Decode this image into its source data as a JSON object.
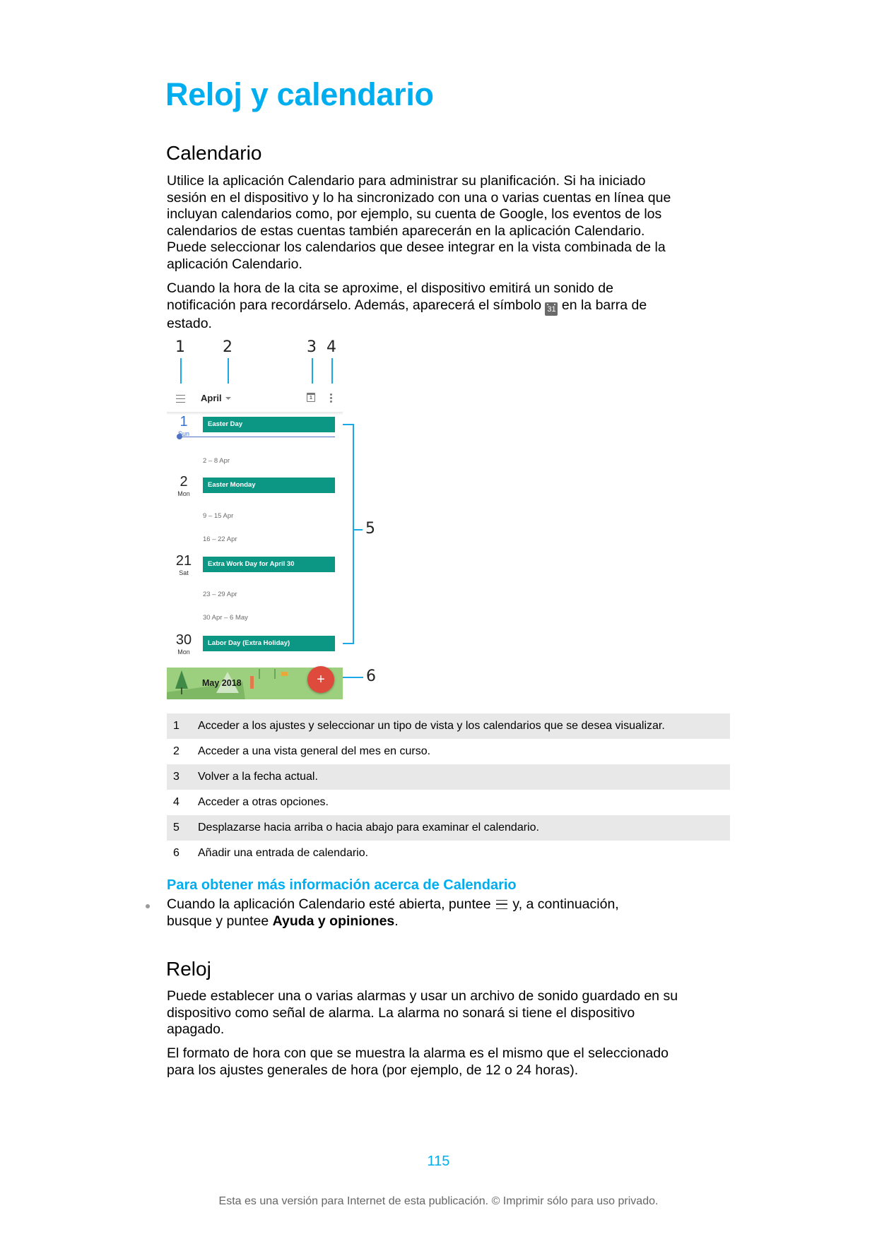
{
  "title": "Reloj y calendario",
  "calendar_section": {
    "heading": "Calendario",
    "para1_lines": [
      "Utilice la aplicación Calendario para administrar su planificación. Si ha iniciado",
      "sesión en el dispositivo y lo ha sincronizado con una o varias cuentas en línea que",
      "incluyan calendarios como, por ejemplo, su cuenta de Google, los eventos de los",
      "calendarios de estas cuentas también aparecerán en la aplicación Calendario.",
      "Puede seleccionar los calendarios que desee integrar en la vista combinada de la",
      "aplicación Calendario."
    ],
    "para2_line1": "Cuando la hora de la cita se aproxime, el dispositivo emitirá un sonido de",
    "para2_line2_before": "notificación para recordárselo. Además, aparecerá el símbolo ",
    "status_icon": "calendar-31-icon",
    "status_icon_text": "31",
    "para2_line2_after": " en la barra de",
    "para2_line3": "estado."
  },
  "figure": {
    "callouts": [
      "1",
      "2",
      "3",
      "4",
      "5",
      "6"
    ],
    "callout_color": "#1aa8e6",
    "app": {
      "menu_icon": "hamburger-menu-icon",
      "month_label": "April",
      "month_dropdown_icon": "caret-down-icon",
      "today_icon": "calendar-today-icon",
      "today_icon_text": "1",
      "more_icon": "more-vert-icon",
      "days": [
        {
          "num": "1",
          "name": "Sun",
          "event": "Easter Day",
          "today": true
        },
        {
          "num": "2",
          "name": "Mon",
          "event": "Easter Monday"
        },
        {
          "num": "21",
          "name": "Sat",
          "event": "Extra Work Day for April 30"
        },
        {
          "num": "30",
          "name": "Mon",
          "event": "Labor Day (Extra Holiday)"
        }
      ],
      "week_ranges": [
        "2 – 8 Apr",
        "9 – 15 Apr",
        "16 – 22 Apr",
        "23 – 29 Apr",
        "30 Apr – 6 May"
      ],
      "next_month_banner": "May 2018",
      "fab_label": "+",
      "event_color": "#0b9784",
      "fab_color": "#de4b3d"
    }
  },
  "legend_table": [
    {
      "n": "1",
      "text": "Acceder a los ajustes y seleccionar un tipo de vista y los calendarios que se desea visualizar."
    },
    {
      "n": "2",
      "text": "Acceder a una vista general del mes en curso."
    },
    {
      "n": "3",
      "text": "Volver a la fecha actual."
    },
    {
      "n": "4",
      "text": "Acceder a otras opciones."
    },
    {
      "n": "5",
      "text": "Desplazarse hacia arriba o hacia abajo para examinar el calendario."
    },
    {
      "n": "6",
      "text": "Añadir una entrada de calendario."
    }
  ],
  "more_info": {
    "heading": "Para obtener más información acerca de Calendario",
    "bullet_before": "Cuando la aplicación Calendario esté abierta, puntee ",
    "bullet_icon": "hamburger-menu-icon",
    "bullet_middle": " y, a continuación,",
    "bullet_line2_before": "busque y puntee ",
    "bullet_bold": "Ayuda y opiniones",
    "bullet_after": "."
  },
  "clock_section": {
    "heading": "Reloj",
    "para1_lines": [
      "Puede establecer una o varias alarmas y usar un archivo de sonido guardado en su",
      "dispositivo como señal de alarma. La alarma no sonará si tiene el dispositivo",
      "apagado."
    ],
    "para2_lines": [
      "El formato de hora con que se muestra la alarma es el mismo que el seleccionado",
      "para los ajustes generales de hora (por ejemplo, de 12 o 24 horas)."
    ]
  },
  "page_number": "115",
  "footer": "Esta es una versión para Internet de esta publicación. © Imprimir sólo para uso privado.",
  "colors": {
    "accent": "#00aeef",
    "table_shade": "#e8e8e8"
  }
}
